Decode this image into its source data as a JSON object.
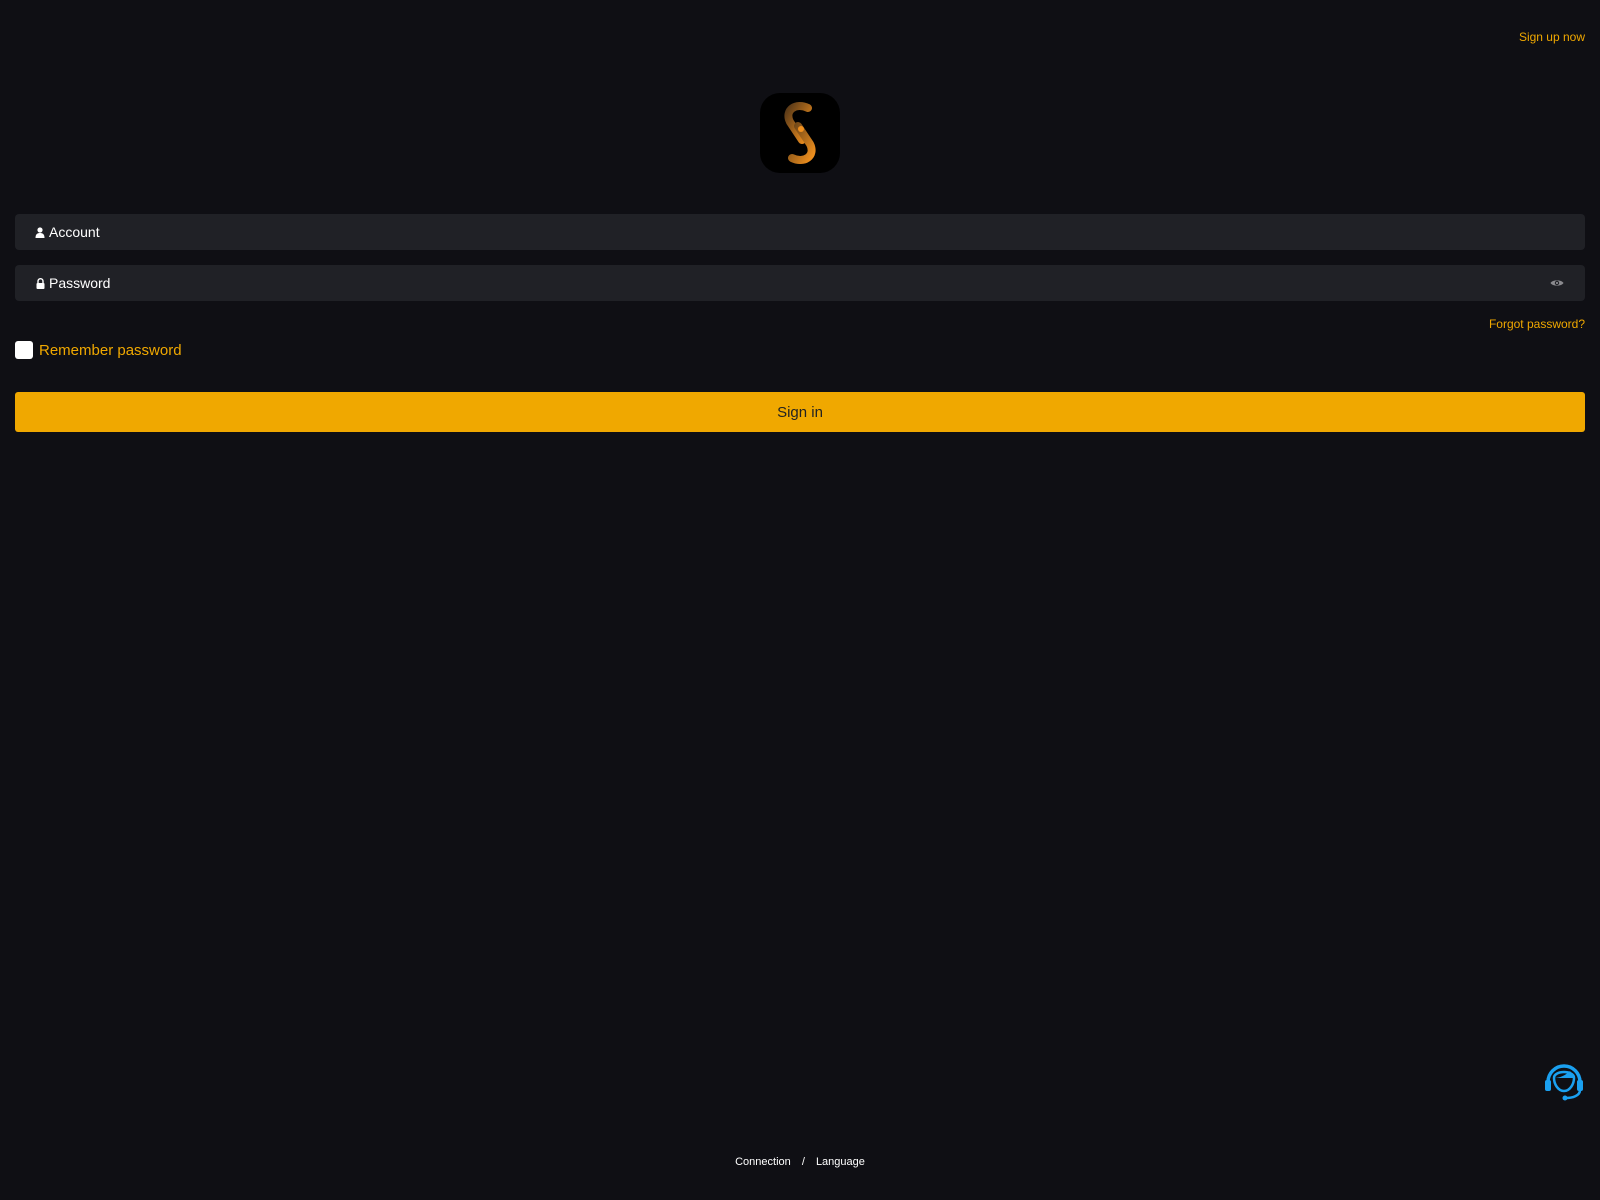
{
  "header": {
    "signup_label": "Sign up now"
  },
  "logo": {
    "icon": "s-link-logo-icon",
    "accent_color": "#e8841a"
  },
  "form": {
    "account_placeholder": "Account",
    "password_placeholder": "Password",
    "forgot_label": "Forgot password?",
    "remember_label": "Remember password",
    "remember_checked": false,
    "signin_label": "Sign in"
  },
  "footer": {
    "connection_label": "Connection",
    "separator": "/",
    "language_label": "Language"
  },
  "colors": {
    "background": "#0f0f14",
    "field_background": "#202126",
    "accent": "#f0a800",
    "support_icon": "#1aa0f0"
  }
}
